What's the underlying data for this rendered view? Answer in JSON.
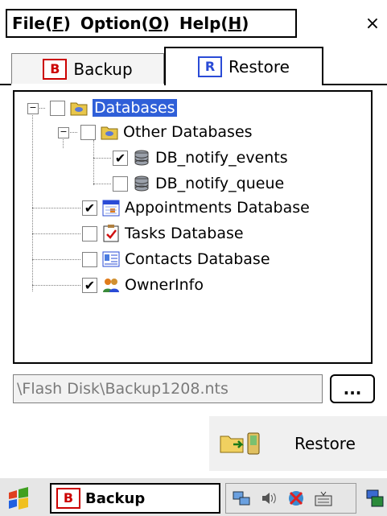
{
  "menu": {
    "file": {
      "text": "File(",
      "key": "F",
      "end": ")"
    },
    "option": {
      "text": "Option(",
      "key": "O",
      "end": ")"
    },
    "help": {
      "text": "Help(",
      "key": "H",
      "end": ")"
    },
    "close": "×"
  },
  "tabs": {
    "backup": {
      "icon_letter": "B",
      "label": "Backup"
    },
    "restore": {
      "icon_letter": "R",
      "label": "Restore"
    }
  },
  "tree": {
    "root": {
      "label": "Databases",
      "checked": false,
      "expander": "−"
    },
    "other": {
      "label": "Other Databases",
      "checked": false,
      "expander": "−"
    },
    "items": [
      {
        "label": "DB_notify_events",
        "checked": "✔"
      },
      {
        "label": "DB_notify_queue",
        "checked": ""
      },
      {
        "label": "Appointments Database",
        "checked": "✔"
      },
      {
        "label": "Tasks Database",
        "checked": ""
      },
      {
        "label": "Contacts Database",
        "checked": ""
      },
      {
        "label": "OwnerInfo",
        "checked": "✔"
      }
    ]
  },
  "path": {
    "value": "\\Flash Disk\\Backup1208.nts",
    "browse_label": "..."
  },
  "restore_button": {
    "label": "Restore"
  },
  "taskbar": {
    "app_icon_letter": "B",
    "app_label": "Backup"
  },
  "colors": {
    "selection": "#2f5fd8",
    "backup_red": "#cc0000",
    "restore_blue": "#2a4bd6"
  }
}
